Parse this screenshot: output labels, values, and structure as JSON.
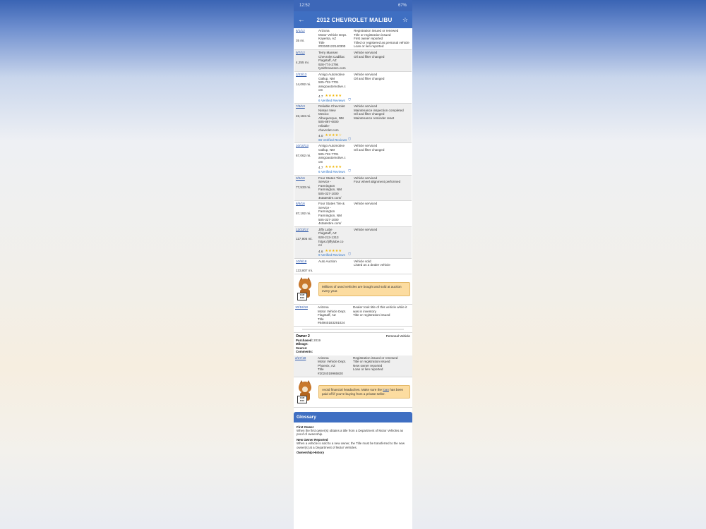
{
  "status": {
    "time": "12:52",
    "battery": "67%"
  },
  "appbar": {
    "title": "2012 CHEVROLET MALIBU",
    "back_icon": "arrow-left-icon",
    "fav_icon": "star-icon"
  },
  "records": [
    {
      "date": "8/1/12",
      "miles": "35 mi.",
      "source": [
        "Arizona",
        "Motor Vehicle Dept.",
        "Kayenta, AZ",
        "Title",
        "#03340122140300"
      ],
      "comments": [
        "Registration issued or renewed",
        "Title or registration issued",
        "First owner reported",
        "Titled or registered as personal vehicle",
        "Loan or lien reported"
      ]
    },
    {
      "date": "9/7/12",
      "miles": "4,255 mi.",
      "source": [
        "Terry Mansen",
        "Chevrolet Cadillac",
        "Flagstaff, AZ",
        "928-774-2794",
        "tymithmansen.com"
      ],
      "comments": [
        "Vehicle serviced",
        "Oil and filter changed"
      ]
    },
    {
      "date": "2/23/13",
      "miles": "14,092 mi.",
      "source": [
        "Amigo Automotive",
        "Gallup, NM",
        "505-722-7701",
        "amigoautomotive.c",
        "om"
      ],
      "comments": [
        "Vehicle serviced",
        "Oil and filter changed"
      ],
      "rating": "4.7",
      "stars": "★★★★★",
      "reviews": "6 Verified Reviews"
    },
    {
      "date": "7/8/13",
      "miles": "22,184 mi.",
      "source": [
        "Reliable Chevrolet",
        "Nissan New",
        "Mexico",
        "Albuquerque, NM",
        "505-897-6000",
        "reliable-",
        "chevrolet.com"
      ],
      "comments": [
        "Vehicle serviced",
        "Maintenance inspection completed",
        "Oil and filter changed",
        "Maintenance reminder reset"
      ],
      "rating": "4.0",
      "stars": "★★★★☆",
      "reviews": "66 Verified Reviews"
    },
    {
      "date": "10/10/13",
      "miles": "67,062 mi.",
      "source": [
        "Amigo Automotive",
        "Gallup, NM",
        "505-722-7701",
        "amigoautomotive.c",
        "om"
      ],
      "comments": [
        "Vehicle serviced",
        "Oil and filter changed"
      ],
      "rating": "4.7",
      "stars": "★★★★★",
      "reviews": "6 Verified Reviews"
    },
    {
      "date": "3/5/16",
      "miles": "77,533 mi.",
      "source": [
        "Four States Tire &",
        "Service -",
        "Farmington",
        "Farmington, NM",
        "505-327-1000",
        "4statestire.com/"
      ],
      "comments": [
        "Vehicle serviced",
        "Four wheel alignment performed"
      ]
    },
    {
      "date": "8/6/16",
      "miles": "87,192 mi.",
      "source": [
        "Four States Tire &",
        "Service -",
        "Farmington",
        "Farmington, NM",
        "505-327-1000",
        "4statestire.com/"
      ],
      "comments": [
        "Vehicle serviced"
      ]
    },
    {
      "date": "12/23/17",
      "miles": "117,905 mi.",
      "source": [
        "Jiffy Lube",
        "Flagstaff, AZ",
        "928-213-1313",
        "https://jiffylube.co",
        "m/"
      ],
      "comments": [
        "Vehicle serviced"
      ],
      "rating": "4.6",
      "stars": "★★★★★",
      "reviews": "9 Verified Reviews"
    },
    {
      "date": "10/9/18",
      "miles": "133,807 mi.",
      "source": [
        "Auto Auction"
      ],
      "comments": [
        "Vehicle sold",
        "Listed as a dealer vehicle"
      ]
    }
  ],
  "callout1": "Millions of used vehicles are bought and sold at auction every year.",
  "record_after": {
    "date": "10/18/18",
    "source": [
      "Arizona",
      "Motor Vehicle Dept.",
      "Flagstaff, AZ",
      "Title",
      "#64940183291024"
    ],
    "comments": [
      "Dealer took title of this vehicle while it was in inventory",
      "Title or registration issued"
    ]
  },
  "owner2": {
    "title": "Owner 2",
    "type": "Personal Vehicle",
    "purchased_label": "Purchased:",
    "purchased": "2019",
    "mileage_label": "Mileage:",
    "source_label": "Source:",
    "comments_label": "Comments:",
    "record": {
      "date": "2/27/19",
      "source": [
        "Arizona",
        "Motor Vehicle Dept.",
        "Phoenix, AZ",
        "Title",
        "#2024019965820"
      ],
      "comments": [
        "Registration issued or renewed",
        "Title or registration issued",
        "New owner reported",
        "Loan or lien reported"
      ]
    }
  },
  "callout2": {
    "pre": "Avoid financial headaches. Make sure the",
    "link": "loan",
    "post": "has been paid off if you're buying from a private seller."
  },
  "fox_sign": "CAR FOX",
  "glossary": {
    "title": "Glossary",
    "items": [
      {
        "term": "First Owner",
        "def": "When the first owner(s) obtains a title from a Department of Motor Vehicles as proof of ownership."
      },
      {
        "term": "New Owner Reported",
        "def": "When a vehicle is sold to a new owner, the Title must be transferred to the new owner(s) at a Department of Motor Vehicles."
      },
      {
        "term": "Ownership History",
        "def": ""
      }
    ]
  }
}
